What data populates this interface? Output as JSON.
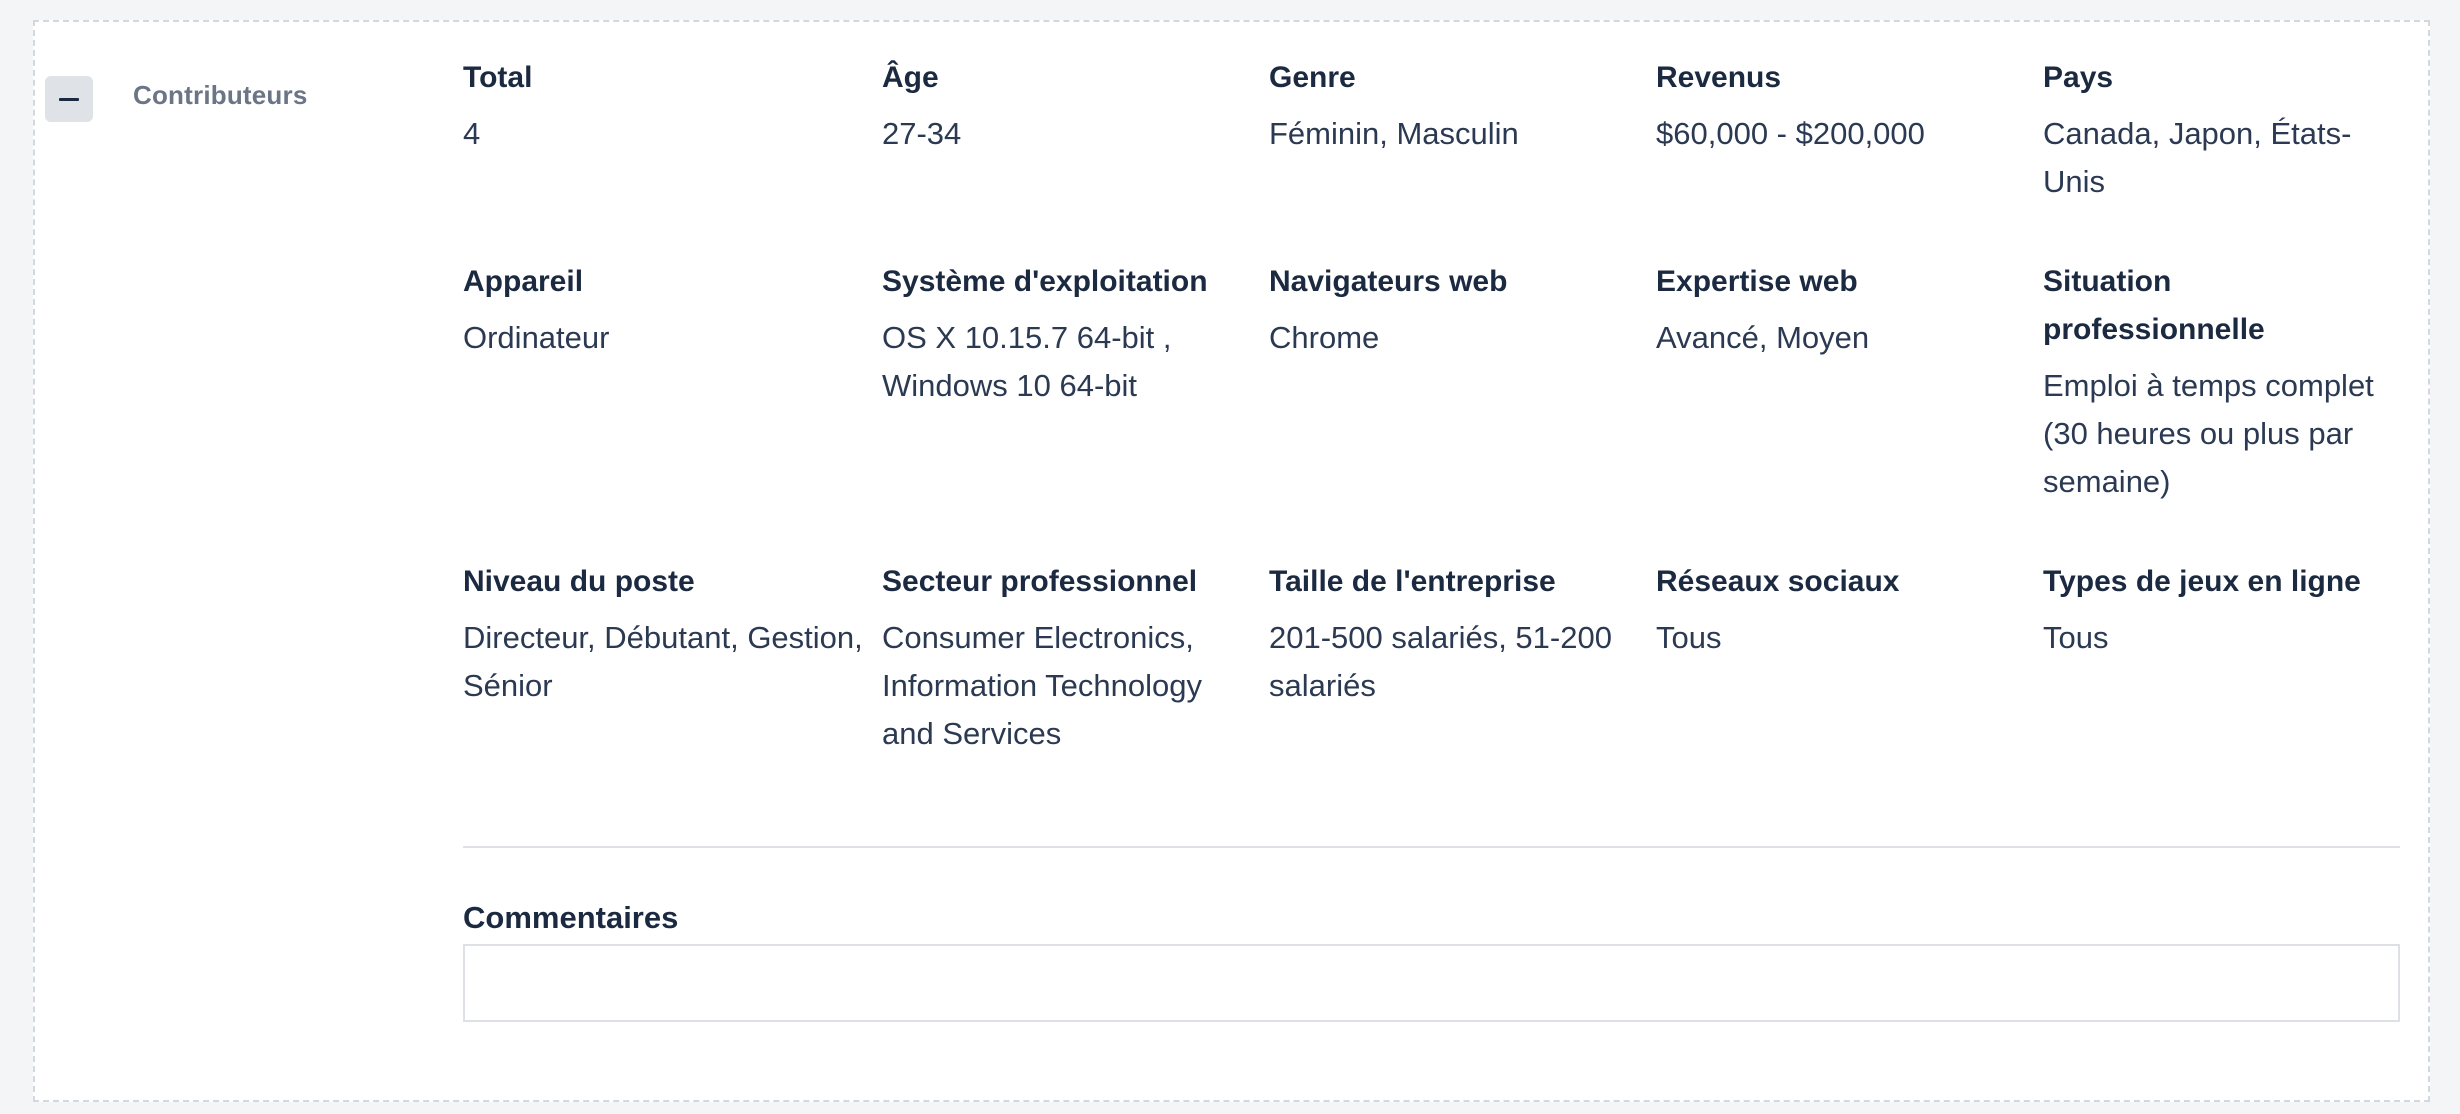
{
  "section": {
    "toggle_icon": "minus-icon",
    "label": "Contributeurs"
  },
  "attributes": [
    [
      {
        "label": "Total",
        "value": "4"
      },
      {
        "label": "Âge",
        "value": "27-34"
      },
      {
        "label": "Genre",
        "value": "Féminin, Masculin"
      },
      {
        "label": "Revenus",
        "value": "$60,000 - $200,000"
      },
      {
        "label": "Pays",
        "value": "Canada, Japon, États-Unis"
      }
    ],
    [
      {
        "label": "Appareil",
        "value": "Ordinateur"
      },
      {
        "label": "Système d'exploitation",
        "value": "OS X 10.15.7 64-bit , Windows 10 64-bit"
      },
      {
        "label": "Navigateurs web",
        "value": "Chrome"
      },
      {
        "label": "Expertise web",
        "value": "Avancé, Moyen"
      },
      {
        "label": "Situation professionnelle",
        "value": "Emploi à temps complet (30 heures ou plus par semaine)"
      }
    ],
    [
      {
        "label": "Niveau du poste",
        "value": "Directeur, Débutant, Gestion, Sénior"
      },
      {
        "label": "Secteur professionnel",
        "value": "Consumer Electronics, Information Technology and Services"
      },
      {
        "label": "Taille de l'entreprise",
        "value": "201-500 salariés, 51-200 salariés"
      },
      {
        "label": "Réseaux sociaux",
        "value": "Tous"
      },
      {
        "label": "Types de jeux en ligne",
        "value": "Tous"
      }
    ]
  ],
  "comments": {
    "label": "Commentaires",
    "value": ""
  }
}
